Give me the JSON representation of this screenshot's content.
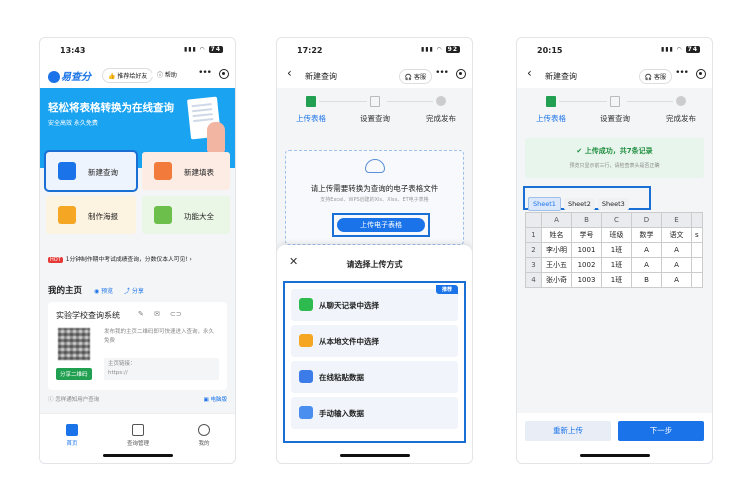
{
  "phone1": {
    "time": "13:43",
    "battery": "74",
    "logo": "易查分",
    "recommend": "推荐给好友",
    "help": "帮助",
    "banner_title": "轻松将表格转换为在线查询",
    "banner_sub": "安全高效 永久免费",
    "cards": [
      "新建查询",
      "新建填表",
      "制作海报",
      "功能大全"
    ],
    "hot_tag": "HOT",
    "hot_text": "1分钟制作期中考试成绩查询，分数仅本人可见!",
    "home_title": "我的主页",
    "preview": "预览",
    "share": "分享",
    "school": "实验学校查询系统",
    "card_desc": "发布我的主页二维码即可快速进入查询，永久免费",
    "share_qr": "分享二维码",
    "link_label": "主页链接：",
    "link_value": "https://",
    "notify": "怎样通知用户查询",
    "pc": "电脑版",
    "tabs": [
      "首页",
      "查询管理",
      "我的"
    ]
  },
  "phone2": {
    "time": "17:22",
    "battery": "92",
    "title": "新建查询",
    "service": "客服",
    "steps": [
      "上传表格",
      "设置查询",
      "完成发布"
    ],
    "upload_text": "请上传需要转换为查询的电子表格文件",
    "upload_hint": "支持Excel、WPS创建的Xls、Xlsx、ET电子表格",
    "upload_button": "上传电子表格",
    "sheet_title": "请选择上传方式",
    "recommend_badge": "推荐",
    "options": [
      "从聊天记录中选择",
      "从本地文件中选择",
      "在线粘贴数据",
      "手动输入数据"
    ]
  },
  "phone3": {
    "time": "20:15",
    "battery": "74",
    "title": "新建查询",
    "service": "客服",
    "steps": [
      "上传表格",
      "设置查询",
      "完成发布"
    ],
    "success_text": "上传成功，共7条记录",
    "success_hint": "预览只显示前三行，请检查表头是否正确",
    "sheets": [
      "Sheet1",
      "Sheet2",
      "Sheet3"
    ],
    "columns": [
      "",
      "A",
      "B",
      "C",
      "D",
      "E",
      ""
    ],
    "rows": [
      [
        "1",
        "姓名",
        "学号",
        "班级",
        "数学",
        "语文",
        "s"
      ],
      [
        "2",
        "李小明",
        "1001",
        "1班",
        "A",
        "A",
        ""
      ],
      [
        "3",
        "王小五",
        "1002",
        "1班",
        "A",
        "A",
        ""
      ],
      [
        "4",
        "张小奇",
        "1003",
        "1班",
        "B",
        "A",
        ""
      ]
    ],
    "reupload": "重新上传",
    "next": "下一步"
  }
}
